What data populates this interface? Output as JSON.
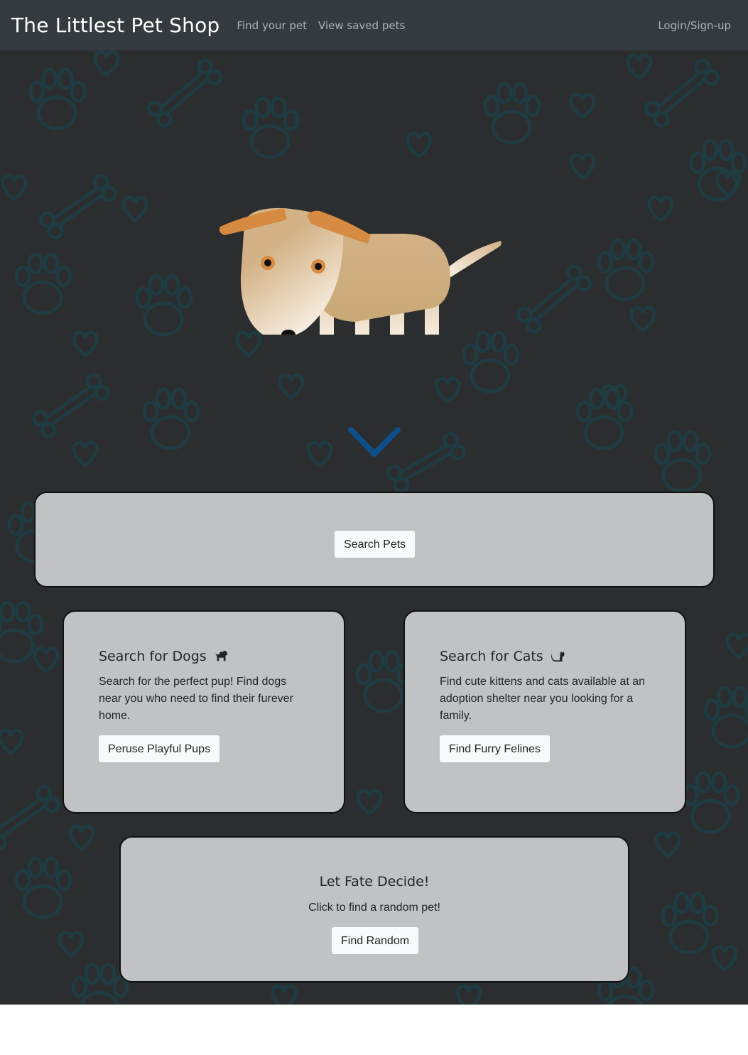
{
  "navbar": {
    "brand": "The Littlest Pet Shop",
    "links": [
      "Find your pet",
      "View saved pets"
    ],
    "login": "Login/Sign-up"
  },
  "hero": {
    "scroll_icon": "chevron-down-icon",
    "accent_color": "#0d4f8b"
  },
  "search_card": {
    "button": "Search Pets"
  },
  "dogs_card": {
    "title": "Search for Dogs",
    "icon": "dog-icon",
    "text": "Search for the perfect pup! Find dogs near you who need to find their furever home.",
    "button": "Peruse Playful Pups"
  },
  "cats_card": {
    "title": "Search for Cats",
    "icon": "cat-icon",
    "text": "Find cute kittens and cats available at an adoption shelter near you looking for a family.",
    "button": "Find Furry Felines"
  },
  "random_card": {
    "title": "Let Fate Decide!",
    "text": "Click to find a random pet!",
    "button": "Find Random"
  },
  "colors": {
    "navbar": "#343a40",
    "background": "#2c2d2e",
    "pattern": "#1f3e44",
    "card": "#cdcfd0"
  }
}
